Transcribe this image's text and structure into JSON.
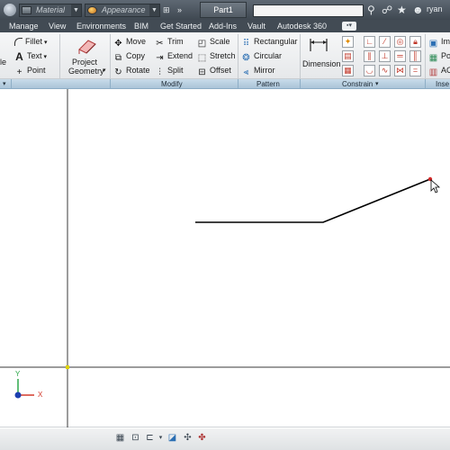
{
  "titlebar": {
    "material_placeholder": "Material",
    "appearance_placeholder": "Appearance",
    "document_tab": "Part1",
    "user_label": "ryan",
    "colors": {
      "bar": "#4a545d",
      "text": "#eef1f3"
    }
  },
  "menu": {
    "tabs": [
      "Manage",
      "View",
      "Environments",
      "BIM",
      "Get Started",
      "Add-Ins",
      "Vault",
      "Autodesk 360"
    ]
  },
  "ribbon": {
    "draw_partial": {
      "label_cut": "le",
      "fillet": "Fillet",
      "text": "Text",
      "point": "Point"
    },
    "project_geometry": {
      "line1": "Project",
      "line2": "Geometry"
    },
    "modify": {
      "move": "Move",
      "trim": "Trim",
      "scale": "Scale",
      "copy": "Copy",
      "extend": "Extend",
      "stretch": "Stretch",
      "rotate": "Rotate",
      "split": "Split",
      "offset": "Offset"
    },
    "pattern": {
      "rectangular": "Rectangular",
      "circular": "Circular",
      "mirror": "Mirror"
    },
    "constrain": {
      "dimension": "Dimension"
    },
    "insert_partial": {
      "image": "Im",
      "points": "Po",
      "acad": "AC"
    }
  },
  "panels": {
    "modify": "Modify",
    "pattern": "Pattern",
    "constrain": "Constrain",
    "insert_cut": "Inse"
  },
  "canvas": {
    "axis_y_label": "Y",
    "axis_x_label": "X",
    "colors": {
      "sketch_line": "#000000",
      "axis_y": "#2ea84a",
      "axis_x": "#d33a2c",
      "origin": "#1c3fb0",
      "endpoint": "#d42a2a"
    }
  },
  "statusbar": {
    "icons": [
      "model-grid-icon",
      "look-at-icon",
      "slice-graphics-icon",
      "constraints-toggle-icon",
      "orbit-icon",
      "pan-icon",
      "zoom-window-icon"
    ]
  }
}
